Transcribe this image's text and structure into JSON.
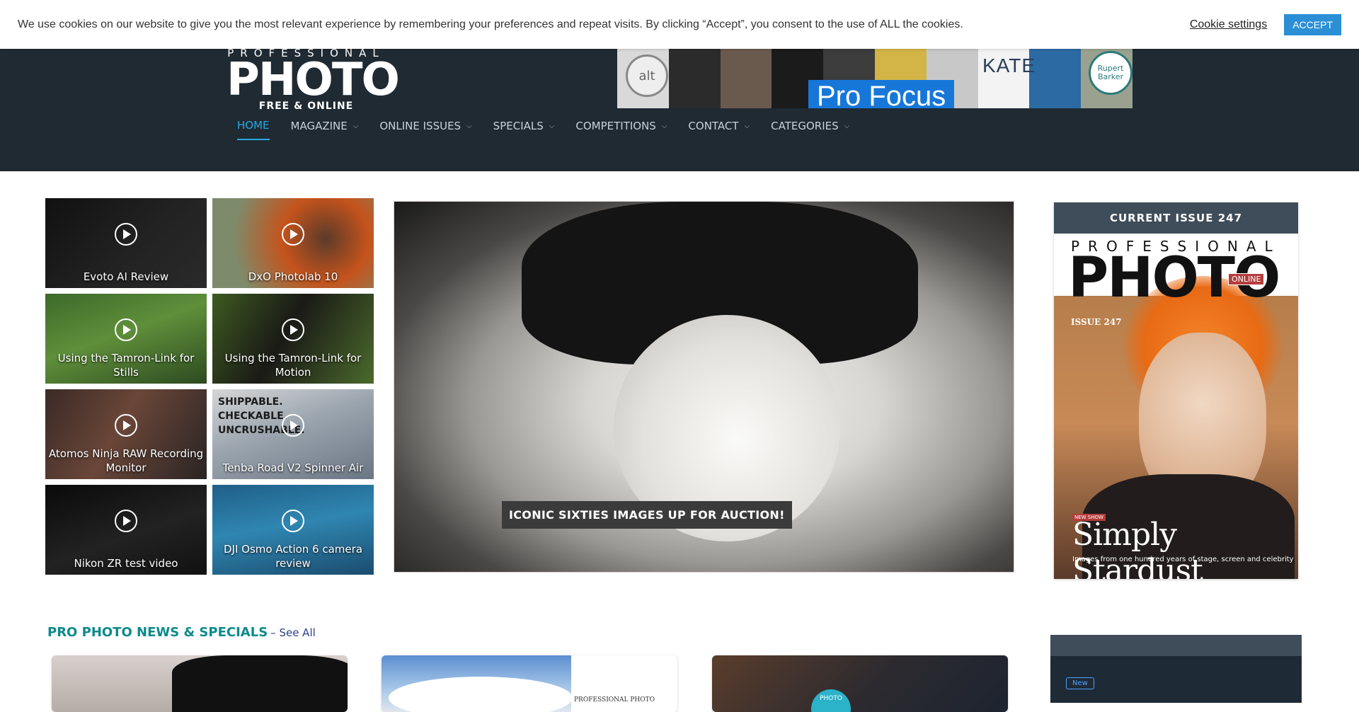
{
  "cookie": {
    "text": "We use cookies on our website to give you the most relevant experience by remembering your preferences and repeat visits. By clicking “Accept”, you consent to the use of ALL the cookies.",
    "settings_label": "Cookie settings",
    "accept_label": "ACCEPT"
  },
  "logo": {
    "top": "PROFESSIONAL",
    "main": "PHOTO",
    "sub": "FREE & ONLINE"
  },
  "banner": {
    "title": "Pro Focus",
    "kate": "KATE",
    "alt": "alt",
    "rb": "Rupert Barker",
    "tile_colors": [
      "#d9d9d9",
      "#2b2b2b",
      "#6a5a4e",
      "#1b1b1b",
      "#3c3c3c",
      "#d3b447",
      "#c8c8c8",
      "#f3f3f3",
      "#2c6aa3",
      "#9aa28f"
    ]
  },
  "nav": {
    "items": [
      {
        "label": "HOME",
        "active": true
      },
      {
        "label": "MAGAZINE",
        "chevron": true
      },
      {
        "label": "ONLINE ISSUES",
        "chevron": true
      },
      {
        "label": "SPECIALS",
        "chevron": true
      },
      {
        "label": "COMPETITIONS",
        "chevron": true
      },
      {
        "label": "CONTACT",
        "chevron": true
      },
      {
        "label": "CATEGORIES",
        "chevron": true
      }
    ]
  },
  "videos": [
    {
      "label": "Evoto AI Review"
    },
    {
      "label": "DxO Photolab 10"
    },
    {
      "label": "Using the Tamron-Link for Stills"
    },
    {
      "label": "Using the Tamron-Link for Motion"
    },
    {
      "label": "Atomos Ninja RAW Recording Monitor"
    },
    {
      "label": "Tenba Road V2 Spinner Air",
      "overlay": [
        "SHIPPABLE.",
        "CHECKABLE.",
        "UNCRUSHABLE."
      ]
    },
    {
      "label": "Nikon ZR test video"
    },
    {
      "label": "DJI Osmo Action 6 camera review"
    }
  ],
  "hero": {
    "caption": "ICONIC SIXTIES IMAGES UP FOR AUCTION!"
  },
  "issue": {
    "header": "CURRENT ISSUE 247",
    "cover_top": "PROFESSIONAL",
    "cover_main": "PHOTO",
    "cover_online": "ONLINE",
    "cover_issue": "ISSUE 247",
    "cover_newshow": "NEW SHOW",
    "cover_headline": "Simply Stardust",
    "cover_tag": "Images from one hundred years of stage, screen and celebrity"
  },
  "news": {
    "title": "PRO PHOTO NEWS & SPECIALS",
    "see_all": "– See All",
    "card2_mag": "PROFESSIONAL PHOTO",
    "card3_badge": "PHOTO"
  },
  "side": {
    "new_badge": "New"
  }
}
